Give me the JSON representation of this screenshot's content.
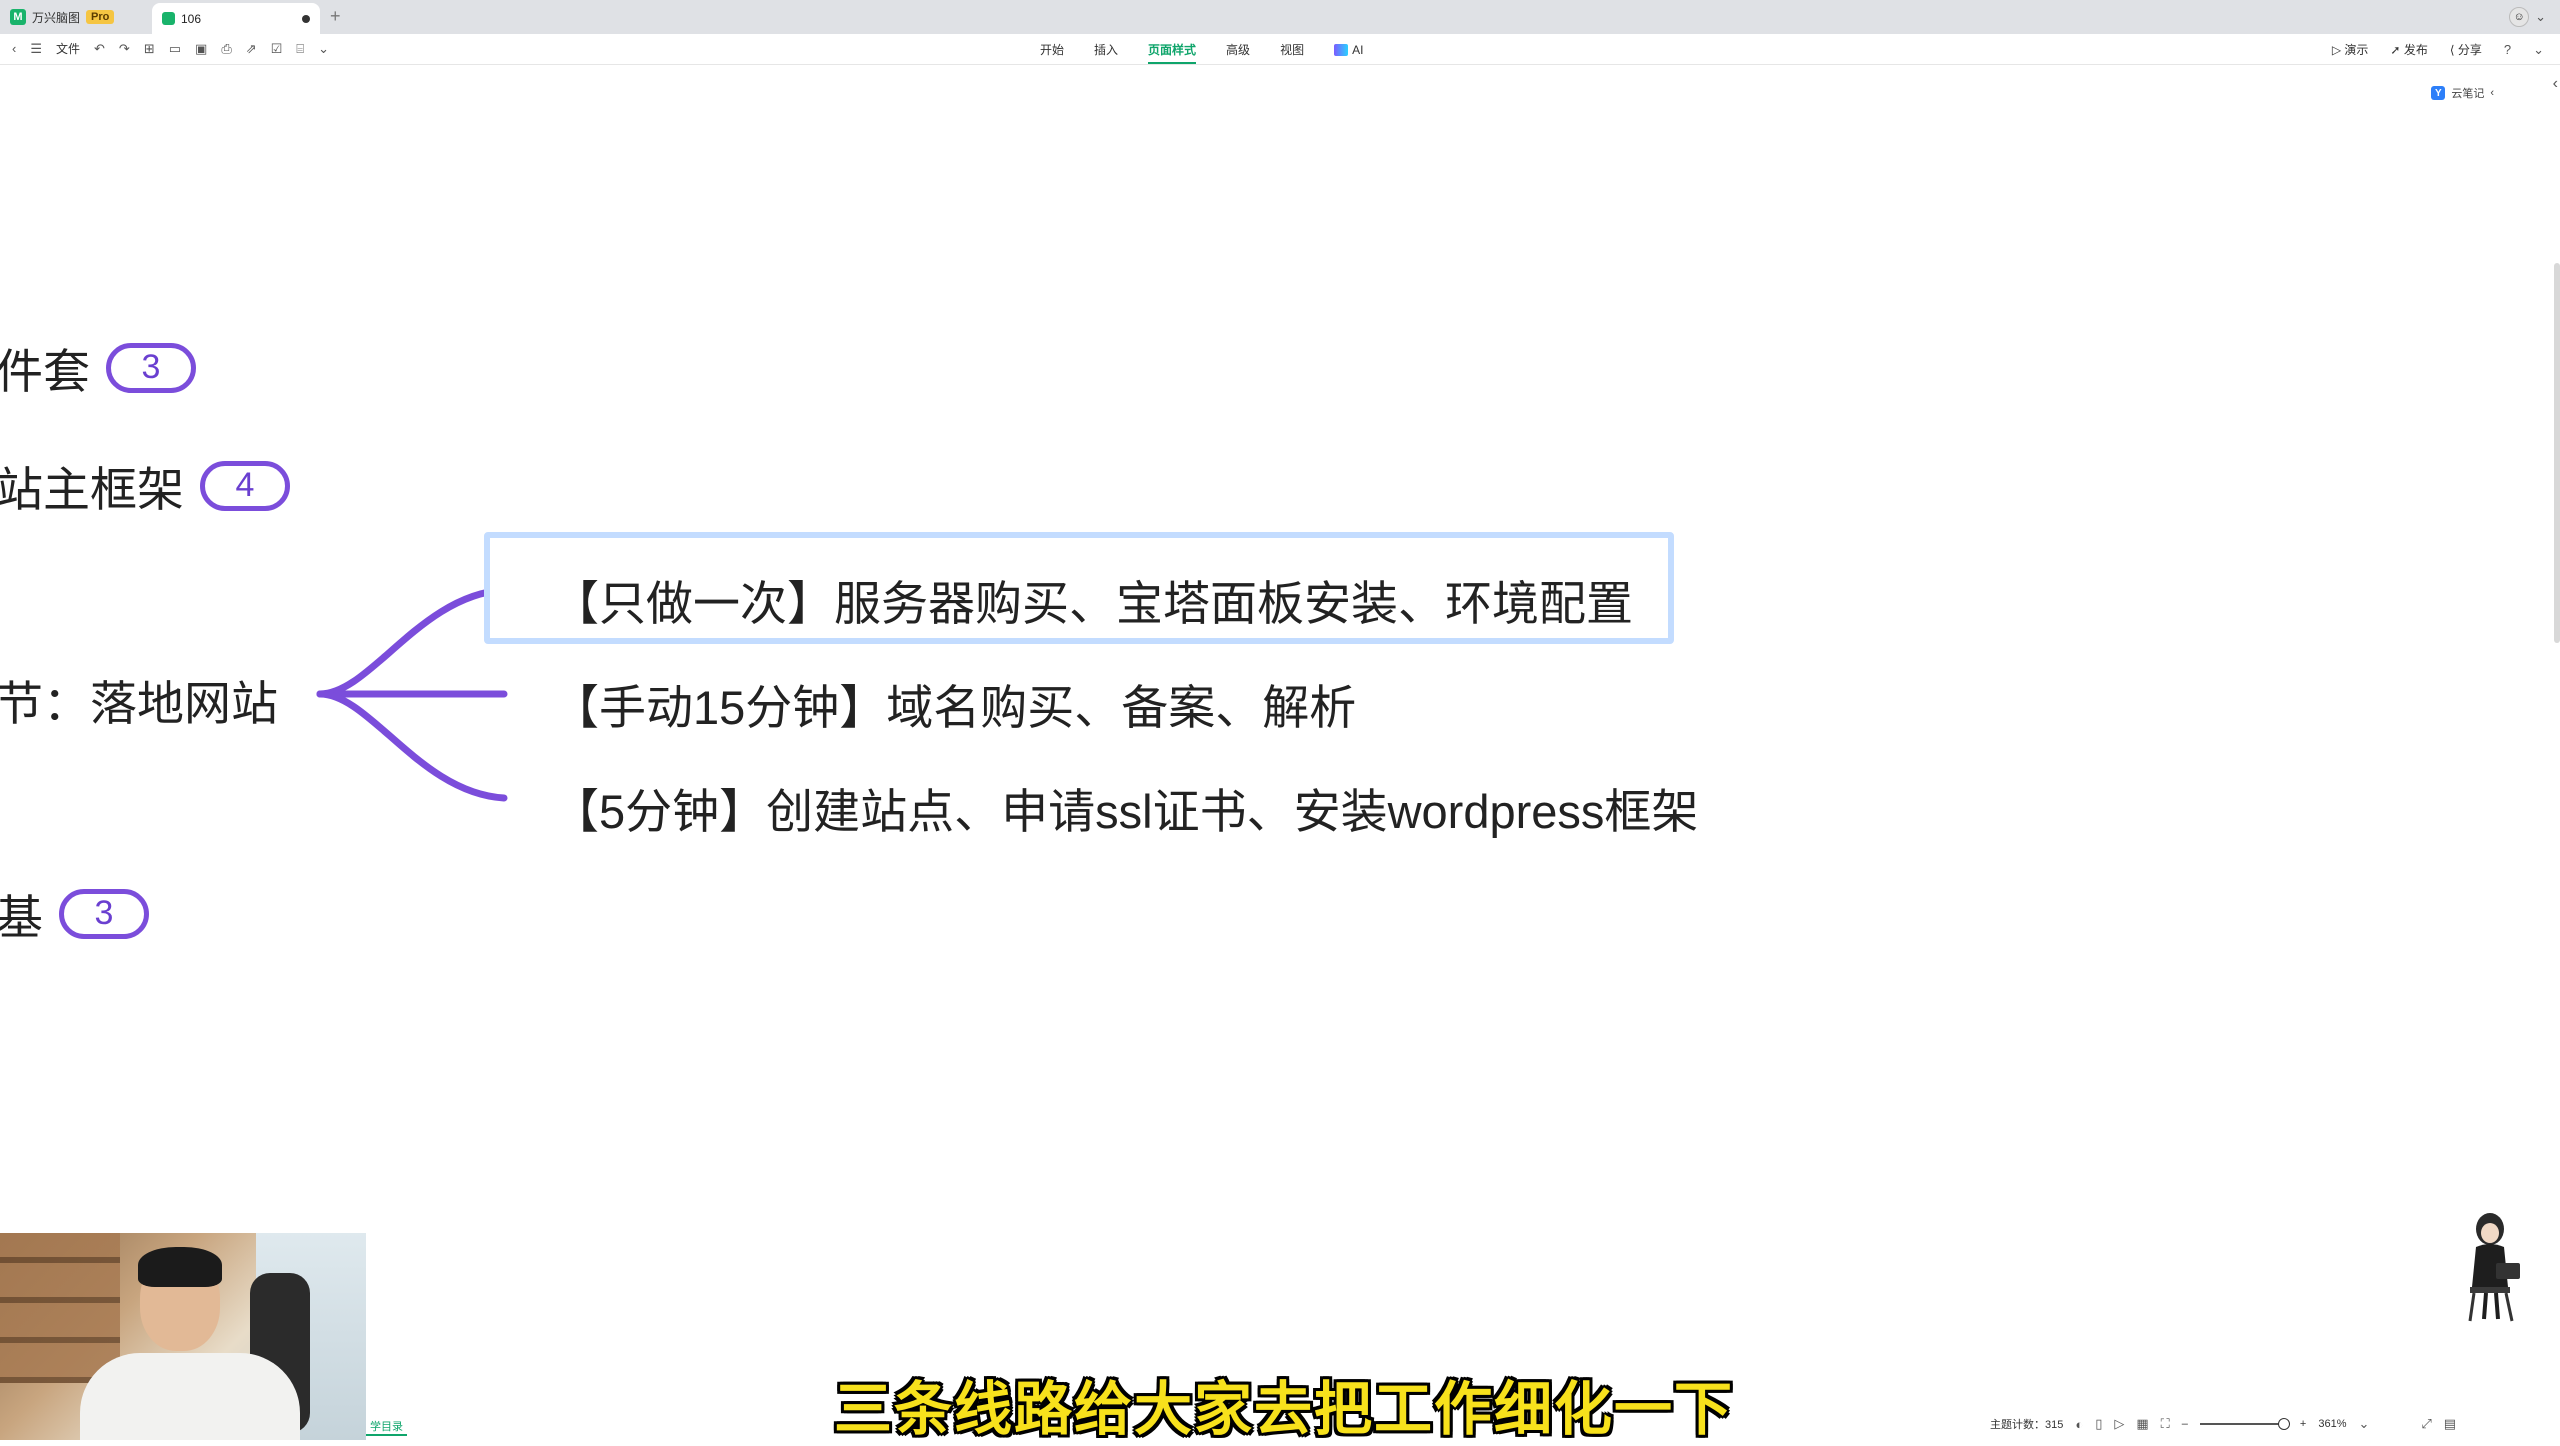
{
  "tabs": {
    "app_name": "万兴脑图",
    "pro_label": "Pro",
    "doc_tab": "106"
  },
  "toolbar": {
    "file_label": "文件",
    "menus": [
      "开始",
      "插入",
      "页面样式",
      "高级",
      "视图"
    ],
    "active_menu": "页面样式",
    "ai_label": "AI",
    "present_label": "演示",
    "publish_label": "发布",
    "share_label": "分享"
  },
  "side": {
    "cloud_notes": "云笔记"
  },
  "mindmap": {
    "partial_nodes": [
      {
        "text": "件套",
        "count": "3"
      },
      {
        "text": "站主框架",
        "count": "4"
      },
      {
        "text": "节：落地网站",
        "count": ""
      },
      {
        "text": "基",
        "count": "3"
      }
    ],
    "children": [
      "【只做一次】服务器购买、宝塔面板安装、环境配置",
      "【手动15分钟】域名购买、备案、解析",
      "【5分钟】创建站点、申请ssl证书、安装wordpress框架"
    ],
    "branch_color": "#7b4ddb"
  },
  "subtitle": "三条线路给大家去把工作细化一下",
  "webcam": {
    "toc_tab": "学目录"
  },
  "status": {
    "topic_count_label": "主题计数：315",
    "zoom": "361%"
  }
}
